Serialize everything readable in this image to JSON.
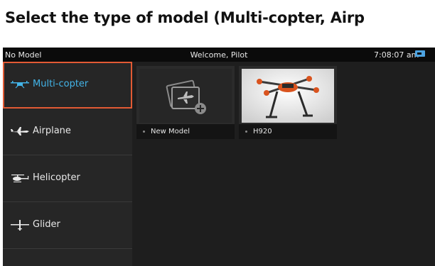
{
  "caption": "Select the type of model (Multi-copter, Airp",
  "statusbar": {
    "model_name": "No Model",
    "welcome": "Welcome, Pilot",
    "time": "7:08:07 am"
  },
  "sidebar": {
    "items": [
      {
        "label": "Multi-copter",
        "icon": "multicopter-icon",
        "selected": true
      },
      {
        "label": "Airplane",
        "icon": "airplane-icon",
        "selected": false
      },
      {
        "label": "Helicopter",
        "icon": "helicopter-icon",
        "selected": false
      },
      {
        "label": "Glider",
        "icon": "glider-icon",
        "selected": false
      }
    ]
  },
  "models": [
    {
      "name": "New Model",
      "thumbnail": "new-model-icon"
    },
    {
      "name": "H920",
      "thumbnail": "hexacopter-photo"
    }
  ],
  "colors": {
    "accent": "#43b4e8",
    "selection_border": "#e25a34",
    "background": "#1f1f1f"
  }
}
